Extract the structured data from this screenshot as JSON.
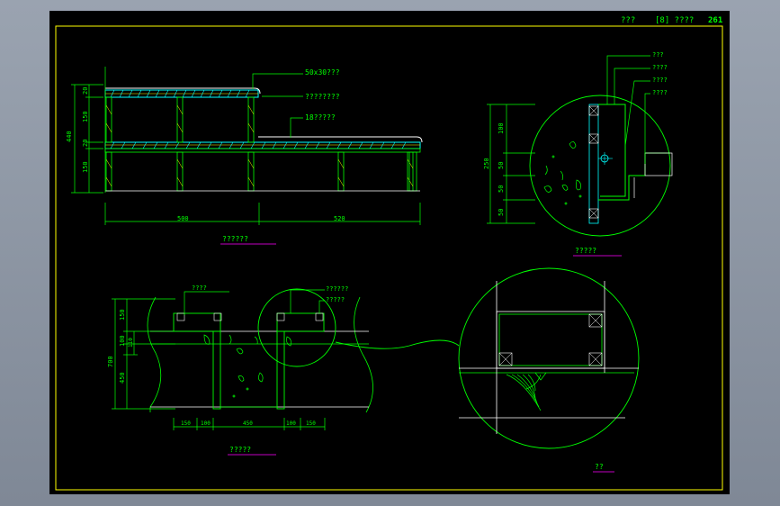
{
  "title_block": {
    "name": "???",
    "sheet_ref": "[8] ????",
    "page_number": "261"
  },
  "elevation": {
    "callouts": [
      "50x30???",
      "????????",
      "18?????"
    ],
    "dims_vertical": [
      "440",
      "150",
      "150",
      "20",
      "20"
    ],
    "dims_horizontal": [
      "500",
      "520"
    ],
    "caption": "??????"
  },
  "detail_section": {
    "callouts": [
      "???",
      "????",
      "????",
      "????"
    ],
    "dims": [
      "250",
      "100",
      "50",
      "50",
      "50"
    ],
    "caption": "?????"
  },
  "plan_section": {
    "callouts": [
      "????",
      "??????",
      "?????"
    ],
    "dims_vertical": [
      "700",
      "150",
      "100",
      "110",
      "450"
    ],
    "dims_horizontal": [
      "150",
      "100",
      "450",
      "100",
      "150"
    ],
    "caption": "?????"
  },
  "enlarged_detail": {
    "caption": "??"
  },
  "colors": {
    "line": "#00ff00",
    "cyan": "#00ffff",
    "white": "#ffffff",
    "yellow": "#ffff00",
    "magenta": "#ff00ff",
    "text": "#00ff00"
  }
}
